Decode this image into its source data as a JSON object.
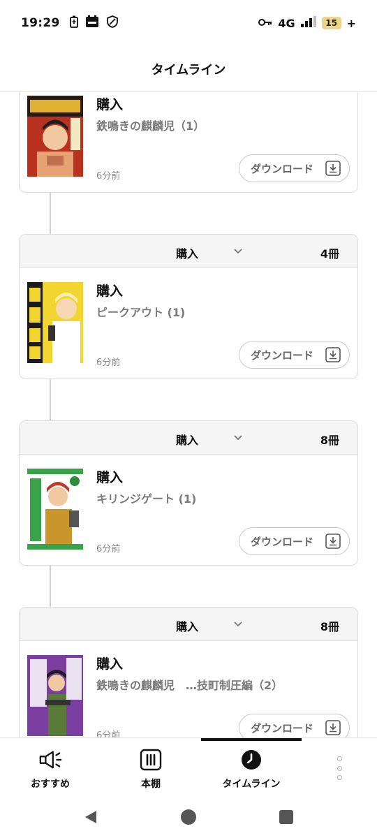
{
  "status_bar": {
    "time": "19:29",
    "network": "4G",
    "battery_level": "15",
    "charging_symbol": "+"
  },
  "header": {
    "title": "タイムライン"
  },
  "timeline": {
    "entries": [
      {
        "group_label": "",
        "group_count": "",
        "action": "購入",
        "title": "鉄鳴きの麒麟児（1）",
        "time": "6分前",
        "download_label": "ダウンロード",
        "cover_color": "#b8321f"
      },
      {
        "group_label": "購入",
        "group_count": "4冊",
        "action": "購入",
        "title": "ピークアウト (1)",
        "time": "6分前",
        "download_label": "ダウンロード",
        "cover_color": "#f2d52e"
      },
      {
        "group_label": "購入",
        "group_count": "8冊",
        "action": "購入",
        "title": "キリンジゲート (1)",
        "time": "6分前",
        "download_label": "ダウンロード",
        "cover_color": "#3aa34a"
      },
      {
        "group_label": "購入",
        "group_count": "8冊",
        "action": "購入",
        "title": "鉄鳴きの麒麟児　…技町制圧編（2）",
        "time": "6分前",
        "download_label": "ダウンロード",
        "cover_color": "#7a3fa0"
      }
    ]
  },
  "bottom_nav": {
    "items": [
      {
        "label": "おすすめ",
        "icon": "megaphone-icon"
      },
      {
        "label": "本棚",
        "icon": "bookshelf-icon"
      },
      {
        "label": "タイムライン",
        "icon": "clock-icon",
        "active": true
      }
    ]
  }
}
